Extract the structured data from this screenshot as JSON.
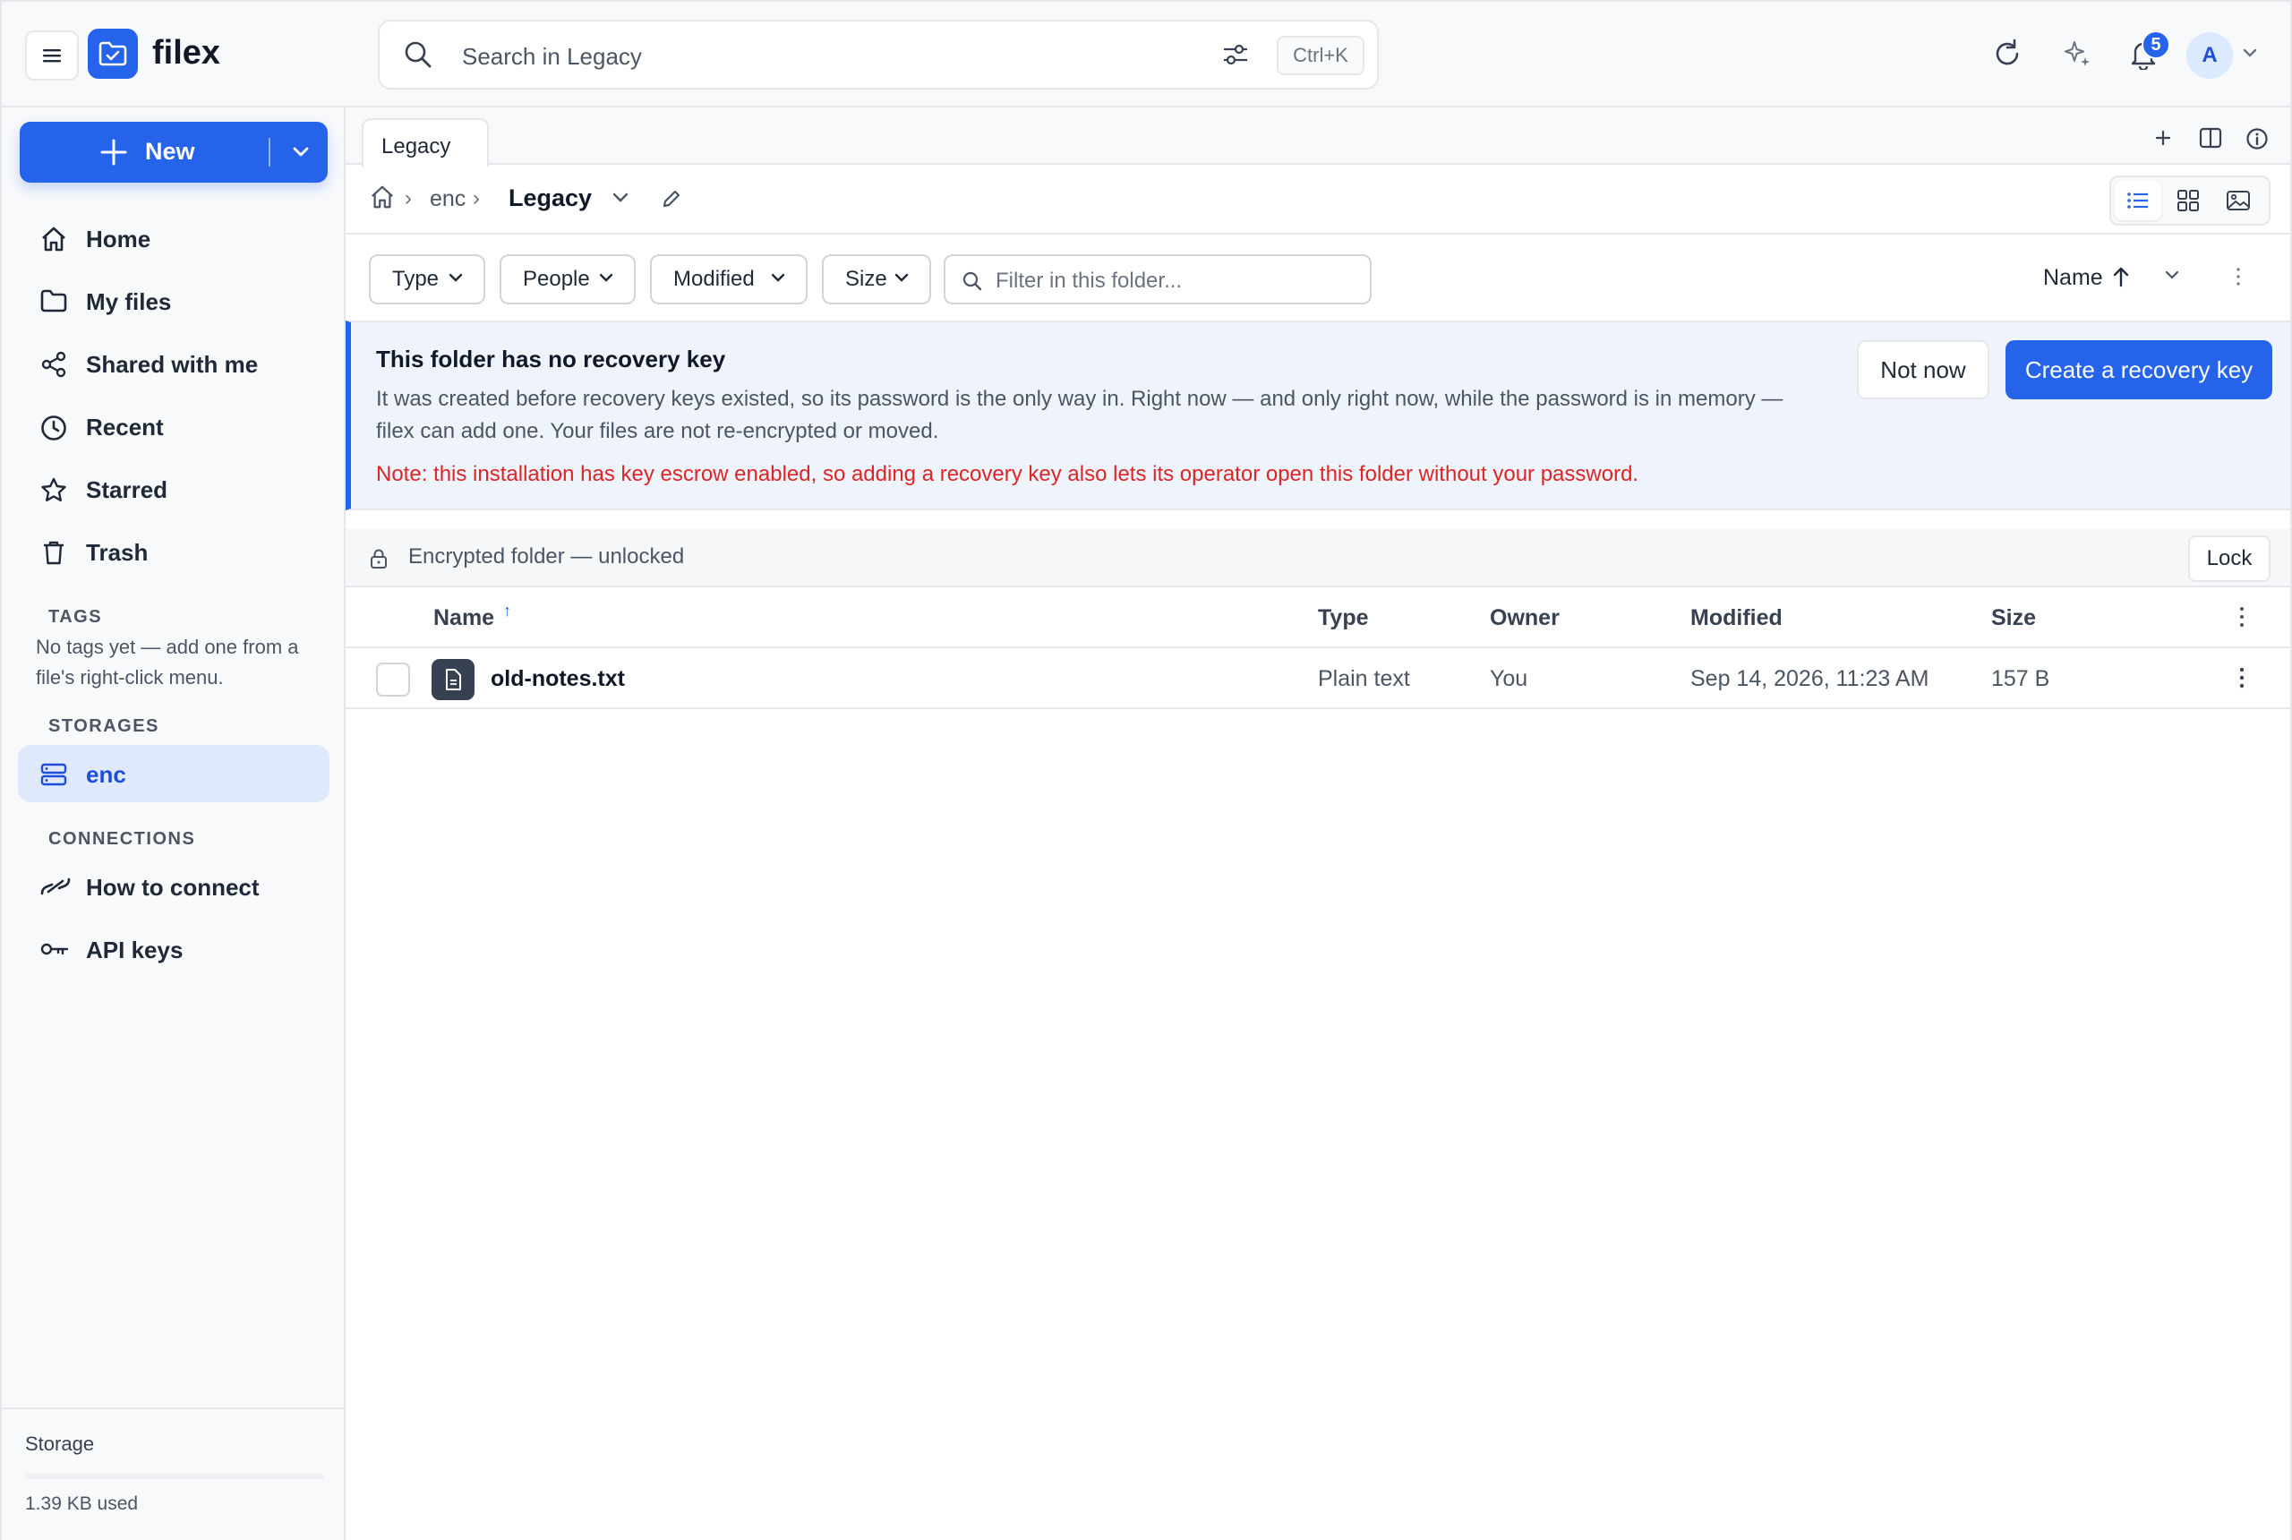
{
  "app": {
    "name": "filex"
  },
  "search": {
    "placeholder": "Search in Legacy",
    "shortcut": "Ctrl+K"
  },
  "header": {
    "notification_count": "5",
    "avatar_initial": "A"
  },
  "sidebar": {
    "new_label": "New",
    "nav": [
      {
        "label": "Home",
        "icon": "home-icon"
      },
      {
        "label": "My files",
        "icon": "folder-icon"
      },
      {
        "label": "Shared with me",
        "icon": "share-icon"
      },
      {
        "label": "Recent",
        "icon": "clock-icon"
      },
      {
        "label": "Starred",
        "icon": "star-icon"
      },
      {
        "label": "Trash",
        "icon": "trash-icon"
      }
    ],
    "tags_label": "TAGS",
    "tags_empty": "No tags yet — add one from a file's right-click menu.",
    "storages_label": "STORAGES",
    "storages": [
      {
        "label": "enc",
        "icon": "server-icon",
        "active": true
      }
    ],
    "connections_label": "CONNECTIONS",
    "connections": [
      {
        "label": "How to connect",
        "icon": "link-icon"
      },
      {
        "label": "API keys",
        "icon": "key-icon"
      }
    ],
    "storage_title": "Storage",
    "storage_used": "1.39 KB used"
  },
  "tabs": [
    {
      "label": "Legacy"
    }
  ],
  "breadcrumb": {
    "root": "enc",
    "current": "Legacy"
  },
  "filters": {
    "chips": [
      "Type",
      "People",
      "Modified",
      "Size"
    ],
    "folder_filter_placeholder": "Filter in this folder...",
    "sort_label": "Name"
  },
  "banner": {
    "title": "This folder has no recovery key",
    "body": "It was created before recovery keys existed, so its password is the only way in. Right now — and only right now, while the password is in memory — filex can add one. Your files are not re-encrypted or moved.",
    "note": "Note: this installation has key escrow enabled, so adding a recovery key also lets its operator open this folder without your password.",
    "secondary_button": "Not now",
    "primary_button": "Create a recovery key"
  },
  "encryption": {
    "status": "Encrypted folder — unlocked",
    "lock_button": "Lock"
  },
  "table": {
    "columns": [
      "Name",
      "Type",
      "Owner",
      "Modified",
      "Size"
    ],
    "rows": [
      {
        "name": "old-notes.txt",
        "type": "Plain text",
        "owner": "You",
        "modified": "Sep 14, 2026, 11:23 AM",
        "size": "157 B"
      }
    ]
  },
  "colors": {
    "accent": "#2563eb",
    "warning_text": "#dc2626",
    "banner_bg": "#eef3fc"
  }
}
